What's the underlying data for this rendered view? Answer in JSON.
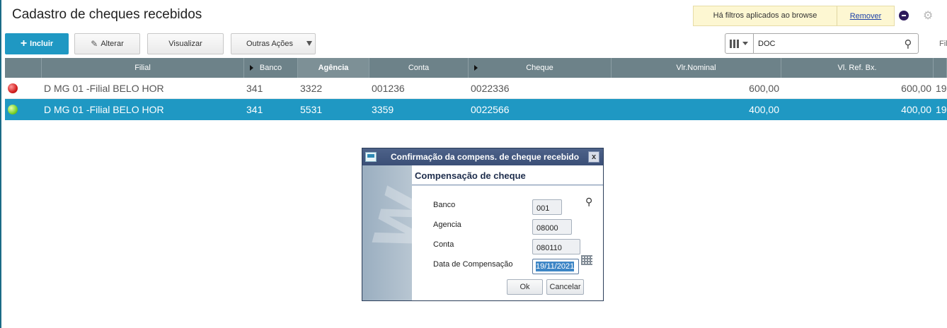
{
  "page": {
    "title": "Cadastro de cheques recebidos"
  },
  "filter_notice": {
    "message": "Há filtros aplicados ao browse",
    "action": "Remover"
  },
  "toolbar": {
    "incluir": "Incluir",
    "alterar": "Alterar",
    "visualizar": "Visualizar",
    "outras": "Outras Ações"
  },
  "search": {
    "value": "DOC",
    "cut_label": "Fil"
  },
  "grid": {
    "columns": [
      "",
      "Filial",
      "Banco",
      "Agência",
      "Conta",
      "Cheque",
      "Vlr.Nominal",
      "Vl. Ref. Bx.",
      ""
    ],
    "rows": [
      {
        "status": "red",
        "filial": "D MG 01 -Filial BELO HOR",
        "banco": "341",
        "agencia": "3322",
        "conta": "001236",
        "cheque": "0022336",
        "vlr_nominal": "600,00",
        "vl_ref_bx": "600,00",
        "extra": "19"
      },
      {
        "status": "green",
        "filial": "D MG 01 -Filial BELO HOR",
        "banco": "341",
        "agencia": "5531",
        "conta": "3359",
        "cheque": "0022566",
        "vlr_nominal": "400,00",
        "vl_ref_bx": "400,00",
        "extra": "19"
      }
    ]
  },
  "dialog": {
    "title": "Confirmação da compens. de cheque recebido",
    "close": "x",
    "section": "Compensação de cheque",
    "fields": {
      "banco_label": "Banco",
      "banco_value": "001",
      "agencia_label": "Agencia",
      "agencia_value": "08000",
      "conta_label": "Conta",
      "conta_value": "080110",
      "data_label": "Data de Compensação",
      "data_value": "19/11/2021"
    },
    "ok": "Ok",
    "cancel": "Cancelar"
  },
  "colors": {
    "accent": "#1f98c3",
    "header": "#6d8289",
    "dialog_title": "#3b4f77"
  }
}
